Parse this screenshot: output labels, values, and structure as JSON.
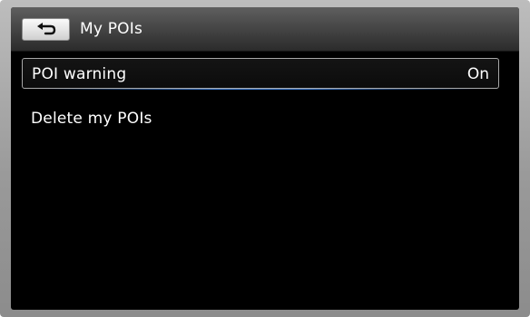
{
  "header": {
    "title": "My POIs",
    "back_icon": "back-arrow-icon"
  },
  "menu": {
    "items": [
      {
        "label": "POI warning",
        "value": "On",
        "selected": true
      },
      {
        "label": "Delete my POIs"
      }
    ]
  },
  "colors": {
    "background": "#000000",
    "text": "#ffffff",
    "focus_line": "#3c7ad2"
  }
}
